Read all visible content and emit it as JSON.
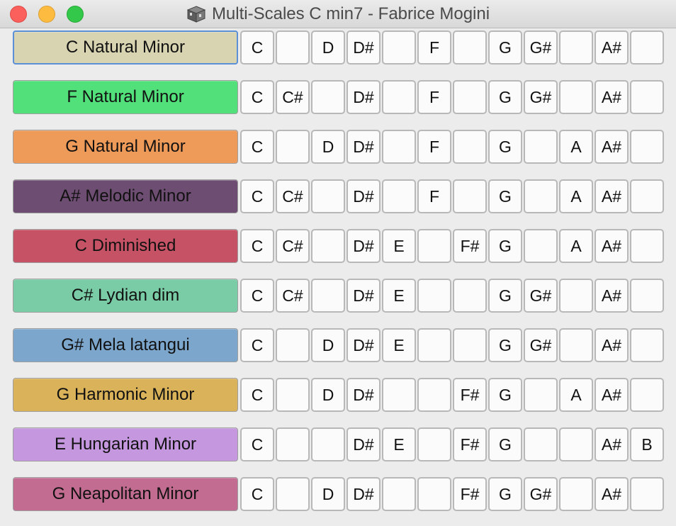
{
  "window": {
    "title": "Multi-Scales C min7 - Fabrice Mogini",
    "icon": "app-cube-icon"
  },
  "rows": [
    {
      "scale": "C Natural Minor",
      "color": "#d8d3b0",
      "selected": true,
      "notes": [
        "C",
        "",
        "D",
        "D#",
        "",
        "F",
        "",
        "G",
        "G#",
        "",
        "A#",
        ""
      ]
    },
    {
      "scale": "F Natural Minor",
      "color": "#52e07a",
      "notes": [
        "C",
        "C#",
        "",
        "D#",
        "",
        "F",
        "",
        "G",
        "G#",
        "",
        "A#",
        ""
      ]
    },
    {
      "scale": "G Natural Minor",
      "color": "#ee9a59",
      "notes": [
        "C",
        "",
        "D",
        "D#",
        "",
        "F",
        "",
        "G",
        "",
        "A",
        "A#",
        ""
      ]
    },
    {
      "scale": "A# Melodic Minor",
      "color": "#6e4d72",
      "notes": [
        "C",
        "C#",
        "",
        "D#",
        "",
        "F",
        "",
        "G",
        "",
        "A",
        "A#",
        ""
      ]
    },
    {
      "scale": "C Diminished",
      "color": "#c65265",
      "notes": [
        "C",
        "C#",
        "",
        "D#",
        "E",
        "",
        "F#",
        "G",
        "",
        "A",
        "A#",
        ""
      ]
    },
    {
      "scale": "C# Lydian dim",
      "color": "#7acca6",
      "notes": [
        "C",
        "C#",
        "",
        "D#",
        "E",
        "",
        "",
        "G",
        "G#",
        "",
        "A#",
        ""
      ]
    },
    {
      "scale": "G# Mela latangui",
      "color": "#7ca6cc",
      "notes": [
        "C",
        "",
        "D",
        "D#",
        "E",
        "",
        "",
        "G",
        "G#",
        "",
        "A#",
        ""
      ]
    },
    {
      "scale": "G Harmonic Minor",
      "color": "#d9b25a",
      "notes": [
        "C",
        "",
        "D",
        "D#",
        "",
        "",
        "F#",
        "G",
        "",
        "A",
        "A#",
        ""
      ]
    },
    {
      "scale": "E Hungarian Minor",
      "color": "#c497de",
      "notes": [
        "C",
        "",
        "",
        "D#",
        "E",
        "",
        "F#",
        "G",
        "",
        "",
        "A#",
        "B"
      ]
    },
    {
      "scale": "G Neapolitan Minor",
      "color": "#c26c91",
      "notes": [
        "C",
        "",
        "D",
        "D#",
        "",
        "",
        "F#",
        "G",
        "G#",
        "",
        "A#",
        ""
      ]
    }
  ]
}
